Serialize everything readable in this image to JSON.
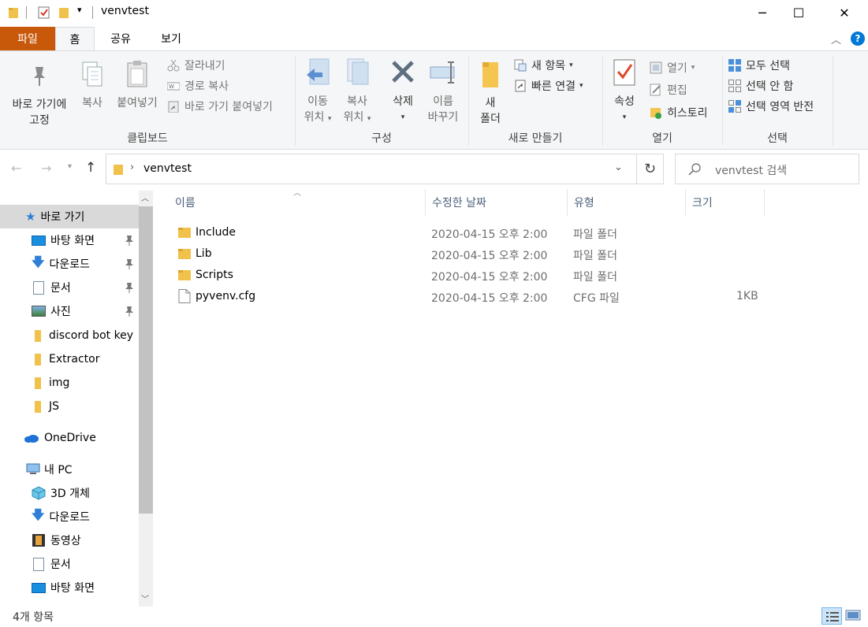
{
  "window": {
    "title": "venvtest"
  },
  "tabs": [
    {
      "label": "파일"
    },
    {
      "label": "홈"
    },
    {
      "label": "공유"
    },
    {
      "label": "보기"
    }
  ],
  "ribbon": {
    "clipboard": {
      "label": "클립보드",
      "pin_line1": "바로 가기에",
      "pin_line2": "고정",
      "copy": "복사",
      "paste": "붙여넣기",
      "cut": "잘라내기",
      "copy_path": "경로 복사",
      "paste_shortcut": "바로 가기 붙여넣기"
    },
    "organize": {
      "label": "구성",
      "move_line1": "이동",
      "move_line2": "위치",
      "copyto_line1": "복사",
      "copyto_line2": "위치",
      "delete": "삭제",
      "rename_line1": "이름",
      "rename_line2": "바꾸기"
    },
    "new": {
      "label": "새로 만들기",
      "new_folder_line1": "새",
      "new_folder_line2": "폴더",
      "new_item": "새 항목",
      "easy_access": "빠른 연결"
    },
    "open": {
      "label": "열기",
      "properties": "속성",
      "open": "열기",
      "edit": "편집",
      "history": "히스토리"
    },
    "select": {
      "label": "선택",
      "select_all": "모두 선택",
      "select_none": "선택 안 함",
      "invert": "선택 영역 반전"
    }
  },
  "address": {
    "path": "venvtest",
    "search_placeholder": "venvtest 검색"
  },
  "nav": {
    "quick_access": "바로 가기",
    "items_pinned": [
      "바탕 화면",
      "다운로드",
      "문서",
      "사진"
    ],
    "items_folders": [
      "discord bot key",
      "Extractor",
      "img",
      "JS"
    ],
    "onedrive": "OneDrive",
    "this_pc": "내 PC",
    "pc_items": [
      "3D 개체",
      "다운로드",
      "동영상",
      "문서",
      "바탕 화면"
    ]
  },
  "columns": {
    "name": "이름",
    "date": "수정한 날짜",
    "type": "유형",
    "size": "크기"
  },
  "files": [
    {
      "name": "Include",
      "date": "2020-04-15 오후 2:00",
      "type": "파일 폴더",
      "size": "",
      "kind": "folder"
    },
    {
      "name": "Lib",
      "date": "2020-04-15 오후 2:00",
      "type": "파일 폴더",
      "size": "",
      "kind": "folder"
    },
    {
      "name": "Scripts",
      "date": "2020-04-15 오후 2:00",
      "type": "파일 폴더",
      "size": "",
      "kind": "folder"
    },
    {
      "name": "pyvenv.cfg",
      "date": "2020-04-15 오후 2:00",
      "type": "CFG 파일",
      "size": "1KB",
      "kind": "file"
    }
  ],
  "status": {
    "count": "4개 항목"
  },
  "colors": {
    "file_tab": "#c8580a",
    "folder": "#f0c24b",
    "accent": "#0078d7"
  }
}
